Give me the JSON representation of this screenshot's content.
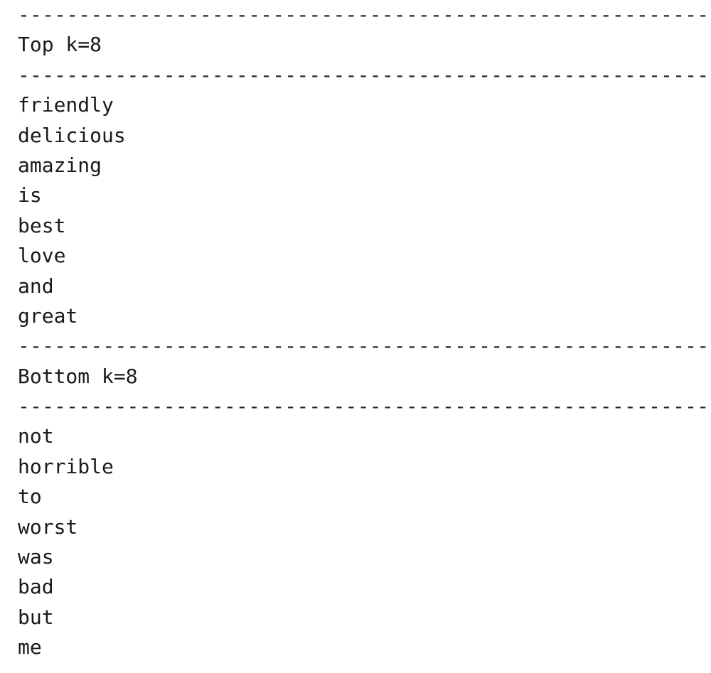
{
  "separator": "----------------------------------------------------------------------",
  "top": {
    "heading": "Top k=8",
    "words": [
      "friendly",
      "delicious",
      "amazing",
      "is",
      "best",
      "love",
      "and",
      "great"
    ]
  },
  "bottom": {
    "heading": "Bottom k=8",
    "words": [
      "not",
      "horrible",
      "to",
      "worst",
      "was",
      "bad",
      "but",
      "me"
    ]
  }
}
